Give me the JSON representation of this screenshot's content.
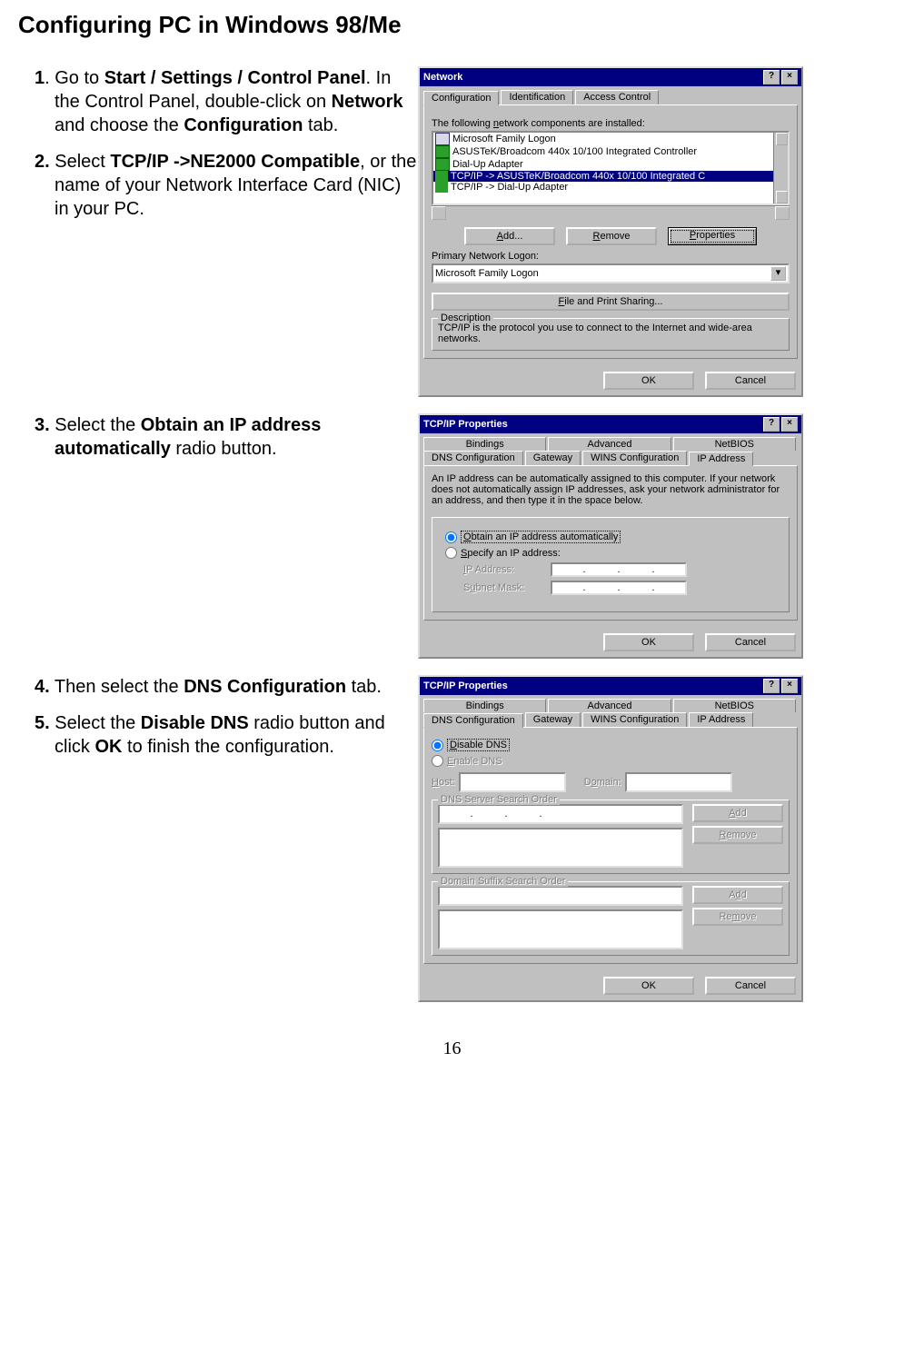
{
  "title": "Configuring PC in Windows 98/Me",
  "page_number": "16",
  "steps": {
    "s1a": "1",
    "s1b": ". Go to ",
    "s1c": "Start / Settings / Control Panel",
    "s1d": ". In the Control Panel, double-click on ",
    "s1e": "Network",
    "s1f": " and choose the ",
    "s1g": "Configuration",
    "s1h": " tab.",
    "s2a": "2.",
    "s2b": " Select ",
    "s2c": "TCP/IP ->NE2000 Compatible",
    "s2d": ", or the name of your Network Interface Card (NIC) in your PC.",
    "s3a": "3.",
    "s3b": " Select the ",
    "s3c": "Obtain an IP address automatically",
    "s3d": " radio button.",
    "s4a": "4.",
    "s4b": " Then select the ",
    "s4c": "DNS Configuration",
    "s4d": " tab.",
    "s5a": "5.",
    "s5b": " Select the ",
    "s5c": "Disable DNS",
    "s5d": " radio button and click ",
    "s5e": "OK",
    "s5f": " to finish the configuration."
  },
  "dlg1": {
    "title": "Network",
    "help": "?",
    "close": "×",
    "tabs": {
      "t1": "Configuration",
      "t2": "Identification",
      "t3": "Access Control"
    },
    "installed_label": "The following network components are installed:",
    "installed_underline": "n",
    "items": {
      "i1": "Microsoft Family Logon",
      "i2": "ASUSTeK/Broadcom 440x 10/100 Integrated Controller",
      "i3": "Dial-Up Adapter",
      "i4": "TCP/IP -> ASUSTeK/Broadcom 440x 10/100 Integrated C",
      "i5": "TCP/IP -> Dial-Up Adapter"
    },
    "btn_add": "Add...",
    "btn_remove": "Remove",
    "btn_properties": "Properties",
    "primary_label": "Primary Network Logon:",
    "primary_value": "Microsoft Family Logon",
    "file_print": "File and Print Sharing...",
    "desc_legend": "Description",
    "desc_text": "TCP/IP is the protocol you use to connect to the Internet and wide-area networks.",
    "ok": "OK",
    "cancel": "Cancel"
  },
  "dlg2": {
    "title": "TCP/IP Properties",
    "help": "?",
    "close": "×",
    "tabs_top": {
      "t1": "Bindings",
      "t2": "Advanced",
      "t3": "NetBIOS"
    },
    "tabs_bot": {
      "t1": "DNS Configuration",
      "t2": "Gateway",
      "t3": "WINS Configuration",
      "t4": "IP Address"
    },
    "desc": "An IP address can be automatically assigned to this computer. If your network does not automatically assign IP addresses, ask your network administrator for an address, and then type it in the space below.",
    "r1": "Obtain an IP address automatically",
    "r1_u": "O",
    "r2": "Specify an IP address:",
    "r2_u": "S",
    "ip_label": "IP Address:",
    "subnet_label": "Subnet Mask:",
    "ok": "OK",
    "cancel": "Cancel"
  },
  "dlg3": {
    "title": "TCP/IP Properties",
    "help": "?",
    "close": "×",
    "tabs_top": {
      "t1": "Bindings",
      "t2": "Advanced",
      "t3": "NetBIOS"
    },
    "tabs_bot": {
      "t1": "DNS Configuration",
      "t2": "Gateway",
      "t3": "WINS Configuration",
      "t4": "IP Address"
    },
    "r1": "Disable DNS",
    "r1_u": "D",
    "r2": "Enable DNS",
    "r2_u": "E",
    "host": "Host:",
    "domain": "Domain:",
    "dns_order": "DNS Server Search Order",
    "dom_order": "Domain Suffix Search Order",
    "add": "Add",
    "remove": "Remove",
    "ok": "OK",
    "cancel": "Cancel"
  }
}
